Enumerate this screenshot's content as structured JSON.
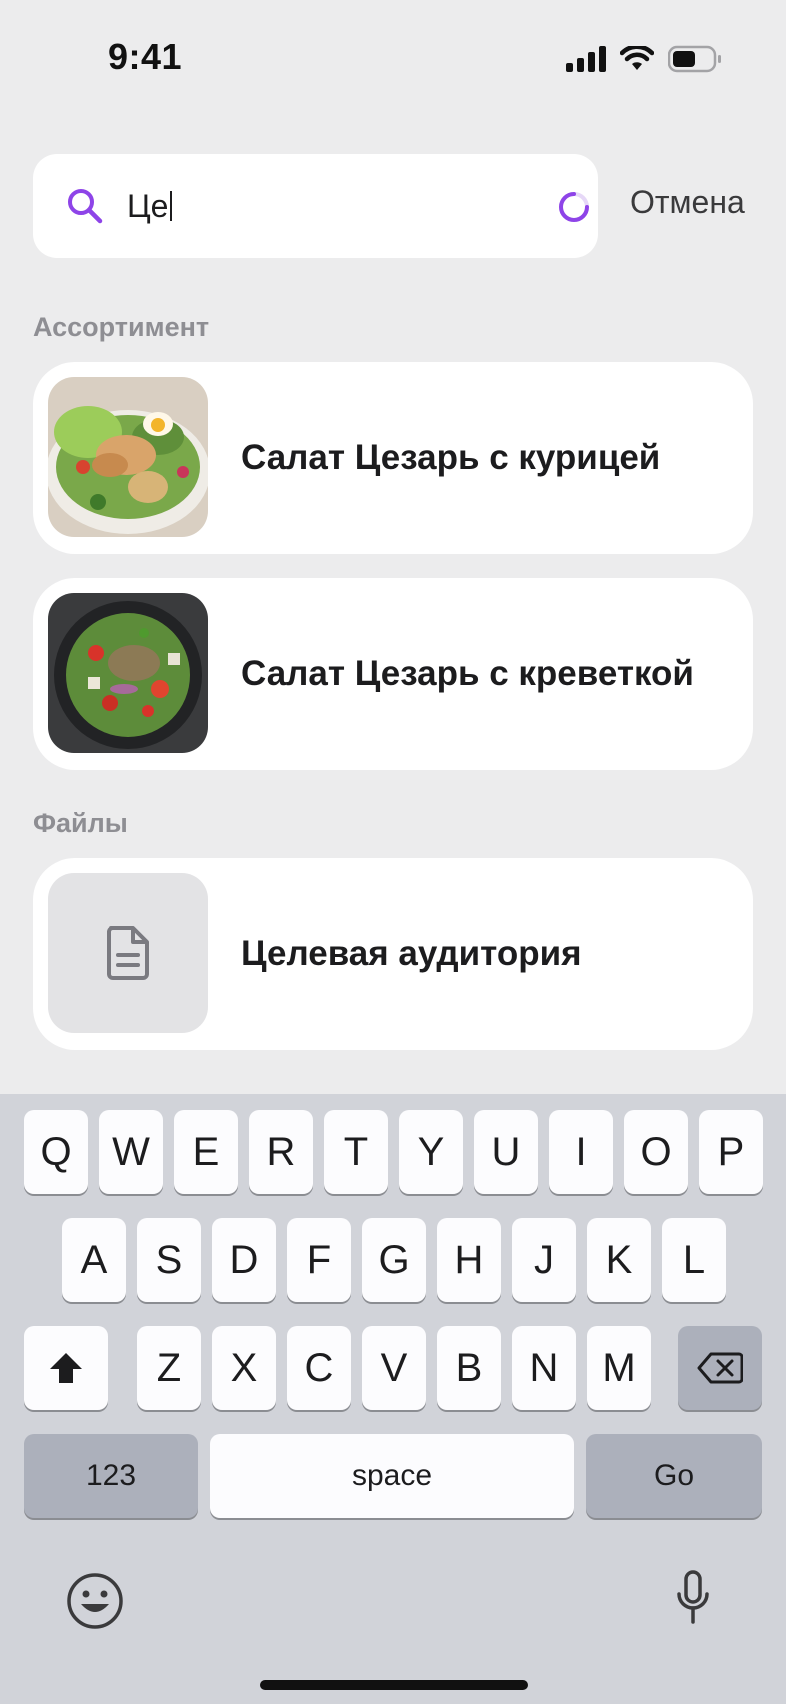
{
  "status_bar": {
    "time": "9:41"
  },
  "search": {
    "query": "Це",
    "cancel_label": "Отмена"
  },
  "sections": {
    "assortment_label": "Ассортимент",
    "files_label": "Файлы"
  },
  "assortment": [
    {
      "title": "Салат Цезарь с курицей"
    },
    {
      "title": "Салат Цезарь с креветкой"
    }
  ],
  "files": [
    {
      "title": "Целевая аудитория"
    }
  ],
  "keyboard": {
    "row1": [
      "Q",
      "W",
      "E",
      "R",
      "T",
      "Y",
      "U",
      "I",
      "O",
      "P"
    ],
    "row2": [
      "A",
      "S",
      "D",
      "F",
      "G",
      "H",
      "J",
      "K",
      "L"
    ],
    "row3": [
      "Z",
      "X",
      "C",
      "V",
      "B",
      "N",
      "M"
    ],
    "numbers_label": "123",
    "space_label": "space",
    "go_label": "Go"
  },
  "colors": {
    "accent": "#8e44e8",
    "background": "#ececed"
  }
}
